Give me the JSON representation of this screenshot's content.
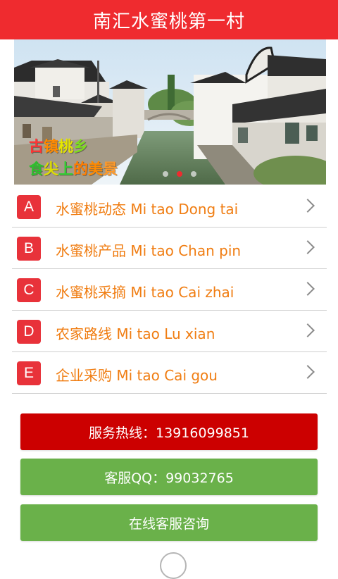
{
  "header": {
    "title": "南汇水蜜桃第一村"
  },
  "banner": {
    "caption_line1_chars": [
      {
        "t": "古",
        "c": "#ff3333"
      },
      {
        "t": "镇",
        "c": "#ff8a00"
      },
      {
        "t": "桃",
        "c": "#e6e600"
      },
      {
        "t": "乡",
        "c": "#7ddc1f"
      }
    ],
    "caption_line2_chars": [
      {
        "t": "食",
        "c": "#2ec02e"
      },
      {
        "t": "尖",
        "c": "#dede00"
      },
      {
        "t": "上",
        "c": "#33cc33"
      },
      {
        "t": "的",
        "c": "#ff7d00"
      },
      {
        "t": "美",
        "c": "#ff8a00"
      },
      {
        "t": "景",
        "c": "#ff9a2a"
      }
    ],
    "dots": 3,
    "active_dot": 1
  },
  "menu": {
    "items": [
      {
        "letter": "A",
        "label": "水蜜桃动态 Mi tao Dong tai"
      },
      {
        "letter": "B",
        "label": "水蜜桃产品 Mi tao Chan pin"
      },
      {
        "letter": "C",
        "label": "水蜜桃采摘 Mi tao Cai zhai"
      },
      {
        "letter": "D",
        "label": "农家路线 Mi tao Lu xian"
      },
      {
        "letter": "E",
        "label": "企业采购 Mi tao Cai gou"
      }
    ]
  },
  "buttons": {
    "hotline": "服务热线：13916099851",
    "qq": "客服QQ：99032765",
    "online": "在线客服咨询"
  },
  "colors": {
    "header": "#ef2b2f",
    "menu_text": "#f07d12",
    "badge": "#e8323a",
    "hotline_button": "#cc0000",
    "green_button": "#6ab14a"
  },
  "icons": {
    "menu_item_arrow": "chevron-right-icon",
    "bottom": "arrow-up-icon"
  }
}
